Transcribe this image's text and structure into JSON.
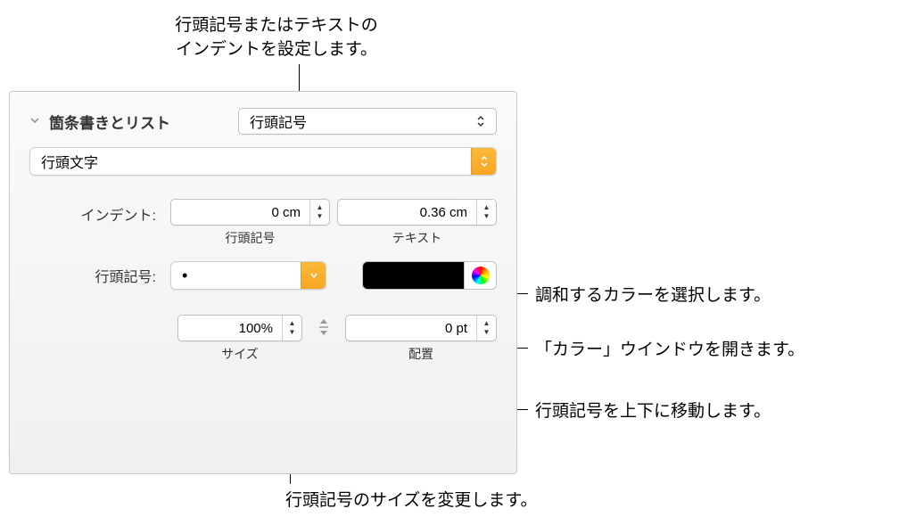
{
  "annotations": {
    "indent": "行頭記号またはテキストの\nインデントを設定します。",
    "colorMatch": "調和するカラーを選択します。",
    "colorWindow": "「カラー」ウインドウを開きます。",
    "moveBullet": "行頭記号を上下に移動します。",
    "sizeChange": "行頭記号のサイズを変更します。"
  },
  "panel": {
    "sectionTitle": "箇条書きとリスト",
    "bulletType": "行頭記号",
    "bulletChar": "行頭文字",
    "indentLabel": "インデント:",
    "indent": {
      "bullet": {
        "value": "0 cm",
        "label": "行頭記号"
      },
      "text": {
        "value": "0.36 cm",
        "label": "テキスト"
      }
    },
    "bulletSymbolLabel": "行頭記号:",
    "bulletSymbol": "•",
    "size": {
      "value": "100%",
      "label": "サイズ"
    },
    "position": {
      "value": "0 pt",
      "label": "配置"
    }
  }
}
